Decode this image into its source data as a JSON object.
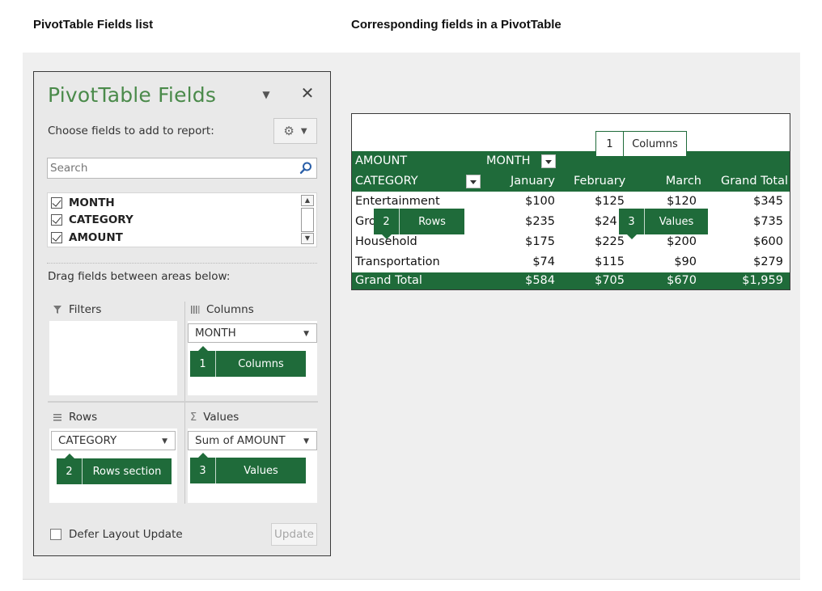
{
  "headings": {
    "left": "PivotTable Fields list",
    "right": "Corresponding fields in a PivotTable"
  },
  "fields_pane": {
    "title": "PivotTable Fields",
    "choose_label": "Choose fields to add to report:",
    "search_placeholder": "Search",
    "fields": [
      {
        "name": "MONTH",
        "checked": true
      },
      {
        "name": "CATEGORY",
        "checked": true
      },
      {
        "name": "AMOUNT",
        "checked": true
      }
    ],
    "drag_label": "Drag fields between areas below:",
    "areas": {
      "filters": {
        "title": "Filters",
        "icon": "filter-icon"
      },
      "columns": {
        "title": "Columns",
        "icon": "columns-icon",
        "field": "MONTH"
      },
      "rows": {
        "title": "Rows",
        "icon": "rows-icon",
        "field": "CATEGORY"
      },
      "values": {
        "title": "Values",
        "icon": "sigma-icon",
        "field": "Sum of AMOUNT"
      }
    },
    "callouts": [
      {
        "num": "1",
        "label": "Columns"
      },
      {
        "num": "2",
        "label": "Rows section"
      },
      {
        "num": "3",
        "label": "Values"
      }
    ],
    "defer_label": "Defer Layout Update",
    "update_label": "Update"
  },
  "pivot_table": {
    "filter_row": {
      "value_field": "AMOUNT",
      "column_field": "MONTH"
    },
    "header_row": {
      "row_field": "CATEGORY",
      "months": [
        "January",
        "February",
        "March"
      ],
      "grand_total": "Grand Total"
    },
    "rows": [
      {
        "category": "Entertainment",
        "values": [
          "$100",
          "$125",
          "$120"
        ],
        "total": "$345"
      },
      {
        "category": "Gro",
        "values": [
          "$235",
          "$24",
          "$"
        ],
        "total": "$735"
      },
      {
        "category": "Household",
        "values": [
          "$175",
          "$225",
          "$200"
        ],
        "total": "$600"
      },
      {
        "category": "Transportation",
        "values": [
          "$74",
          "$115",
          "$90"
        ],
        "total": "$279"
      }
    ],
    "grand_total_row": {
      "label": "Grand Total",
      "values": [
        "$584",
        "$705",
        "$670"
      ],
      "total": "$1,959"
    },
    "callouts": [
      {
        "num": "1",
        "label": "Columns"
      },
      {
        "num": "2",
        "label": "Rows"
      },
      {
        "num": "3",
        "label": "Values"
      }
    ]
  },
  "colors": {
    "accent_green": "#1f6b3a",
    "title_green": "#4a8a4a",
    "stage_bg": "#efefef"
  }
}
